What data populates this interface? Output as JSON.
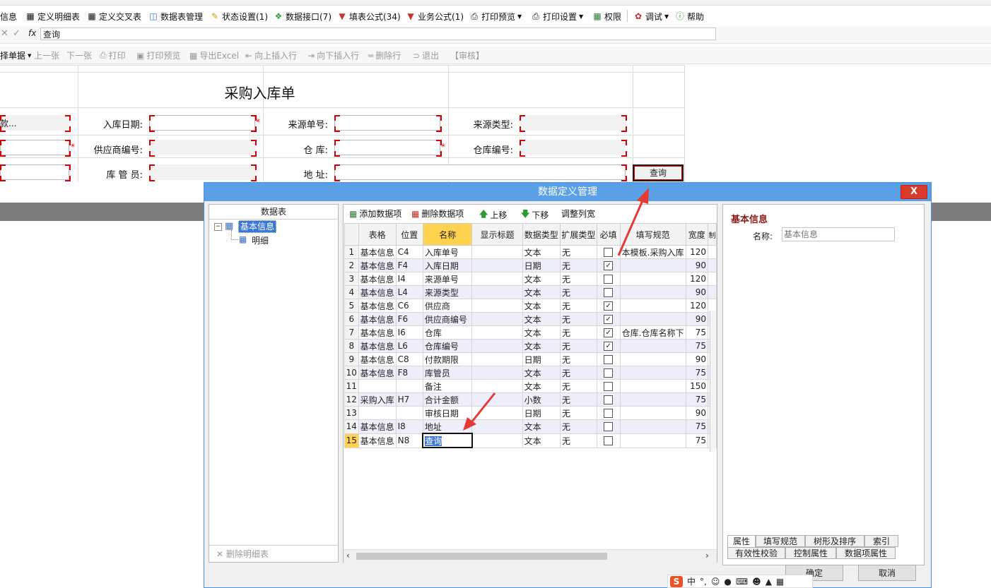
{
  "toolbar": {
    "items": [
      {
        "label": "信息",
        "icon": "info-icon"
      },
      {
        "label": "定义明细表",
        "icon": "table-icon"
      },
      {
        "label": "定义交叉表",
        "icon": "cross-table-icon"
      },
      {
        "label": "数据表管理",
        "icon": "database-icon"
      },
      {
        "label": "状态设置(1)",
        "icon": "status-icon"
      },
      {
        "label": "数据接口(7)",
        "icon": "interface-icon"
      },
      {
        "label": "填表公式(34)",
        "icon": "formula-icon"
      },
      {
        "label": "业务公式(1)",
        "icon": "formula-icon"
      },
      {
        "label": "打印预览",
        "icon": "print-preview-icon"
      },
      {
        "label": "打印设置",
        "icon": "print-settings-icon"
      },
      {
        "label": "权限",
        "icon": "permission-icon"
      },
      {
        "label": "调试",
        "icon": "bug-icon"
      },
      {
        "label": "帮助",
        "icon": "help-icon"
      }
    ]
  },
  "formula_bar": {
    "fx": "fx",
    "value": "查询"
  },
  "toolbar2": {
    "items": [
      "择单据",
      "上一张",
      "下一张",
      "打印",
      "打印预览",
      "导出Excel",
      "向上插入行",
      "向下插入行",
      "删除行",
      "退出",
      "【审核】"
    ]
  },
  "form": {
    "title": "采购入库单",
    "row1_first": "款...",
    "labels": {
      "in_date": "入库日期:",
      "source_no": "来源单号:",
      "source_type": "来源类型:",
      "supplier_no": "供应商编号:",
      "warehouse": "仓 库:",
      "warehouse_no": "仓库编号:",
      "keeper": "库 管 员:",
      "address": "地 址:"
    },
    "query_button": "查询",
    "required_mark": "*"
  },
  "dialog": {
    "title": "数据定义管理",
    "close": "X",
    "left": {
      "header": "数据表",
      "tree_root": "基本信息",
      "tree_child": "明细",
      "delete_button": "删除明细表"
    },
    "mid_toolbar": {
      "add": "添加数据项",
      "delete": "删除数据项",
      "up": "上移",
      "down": "下移",
      "adjust": "调整列宽"
    },
    "columns": [
      "表格",
      "位置",
      "名称",
      "显示标题",
      "数据类型",
      "扩展类型",
      "必填",
      "填写规范",
      "宽度",
      "制"
    ],
    "rows": [
      {
        "n": "1",
        "table": "基本信息",
        "pos": "C4",
        "name": "入库单号",
        "title": "",
        "type": "文本",
        "ext": "无",
        "req": false,
        "rule": "本模板.采购入库",
        "width": "120"
      },
      {
        "n": "2",
        "table": "基本信息",
        "pos": "F4",
        "name": "入库日期",
        "title": "",
        "type": "日期",
        "ext": "无",
        "req": true,
        "rule": "",
        "width": "90"
      },
      {
        "n": "3",
        "table": "基本信息",
        "pos": "I4",
        "name": "来源单号",
        "title": "",
        "type": "文本",
        "ext": "无",
        "req": false,
        "rule": "",
        "width": "120"
      },
      {
        "n": "4",
        "table": "基本信息",
        "pos": "L4",
        "name": "来源类型",
        "title": "",
        "type": "文本",
        "ext": "无",
        "req": false,
        "rule": "",
        "width": "90"
      },
      {
        "n": "5",
        "table": "基本信息",
        "pos": "C6",
        "name": "供应商",
        "title": "",
        "type": "文本",
        "ext": "无",
        "req": true,
        "rule": "",
        "width": "120"
      },
      {
        "n": "6",
        "table": "基本信息",
        "pos": "F6",
        "name": "供应商编号",
        "title": "",
        "type": "文本",
        "ext": "无",
        "req": true,
        "rule": "",
        "width": "90"
      },
      {
        "n": "7",
        "table": "基本信息",
        "pos": "I6",
        "name": "仓库",
        "title": "",
        "type": "文本",
        "ext": "无",
        "req": true,
        "rule": "仓库.仓库名称下",
        "width": "75"
      },
      {
        "n": "8",
        "table": "基本信息",
        "pos": "L6",
        "name": "仓库编号",
        "title": "",
        "type": "文本",
        "ext": "无",
        "req": true,
        "rule": "",
        "width": "75"
      },
      {
        "n": "9",
        "table": "基本信息",
        "pos": "C8",
        "name": "付款期限",
        "title": "",
        "type": "日期",
        "ext": "无",
        "req": false,
        "rule": "",
        "width": "90"
      },
      {
        "n": "10",
        "table": "基本信息",
        "pos": "F8",
        "name": "库管员",
        "title": "",
        "type": "文本",
        "ext": "无",
        "req": false,
        "rule": "",
        "width": "75"
      },
      {
        "n": "11",
        "table": "",
        "pos": "",
        "name": "备注",
        "title": "",
        "type": "文本",
        "ext": "无",
        "req": false,
        "rule": "",
        "width": "150"
      },
      {
        "n": "12",
        "table": "采购入库",
        "pos": "H7",
        "name": "合计金额",
        "title": "",
        "type": "小数",
        "ext": "无",
        "req": false,
        "rule": "",
        "width": "75"
      },
      {
        "n": "13",
        "table": "",
        "pos": "",
        "name": "审核日期",
        "title": "",
        "type": "日期",
        "ext": "无",
        "req": false,
        "rule": "",
        "width": "90"
      },
      {
        "n": "14",
        "table": "基本信息",
        "pos": "I8",
        "name": "地址",
        "title": "",
        "type": "文本",
        "ext": "无",
        "req": false,
        "rule": "",
        "width": "75"
      },
      {
        "n": "15",
        "table": "基本信息",
        "pos": "N8",
        "name": "查询",
        "title": "",
        "type": "文本",
        "ext": "无",
        "req": false,
        "rule": "",
        "width": "75"
      }
    ],
    "right": {
      "header": "基本信息",
      "name_label": "名称:",
      "name_value": "基本信息"
    },
    "tabs_row1": [
      "属性",
      "填写规范",
      "树形及排序",
      "索引"
    ],
    "tabs_row2": [
      "有效性校验",
      "控制属性",
      "数据项属性"
    ],
    "ok": "确定",
    "cancel": "取消"
  },
  "ime": {
    "label": "中"
  },
  "colors": {
    "title_bar": "#5b9fe6",
    "close": "#d93b2b",
    "required": "#d40000",
    "selected": "#ffd34f"
  }
}
